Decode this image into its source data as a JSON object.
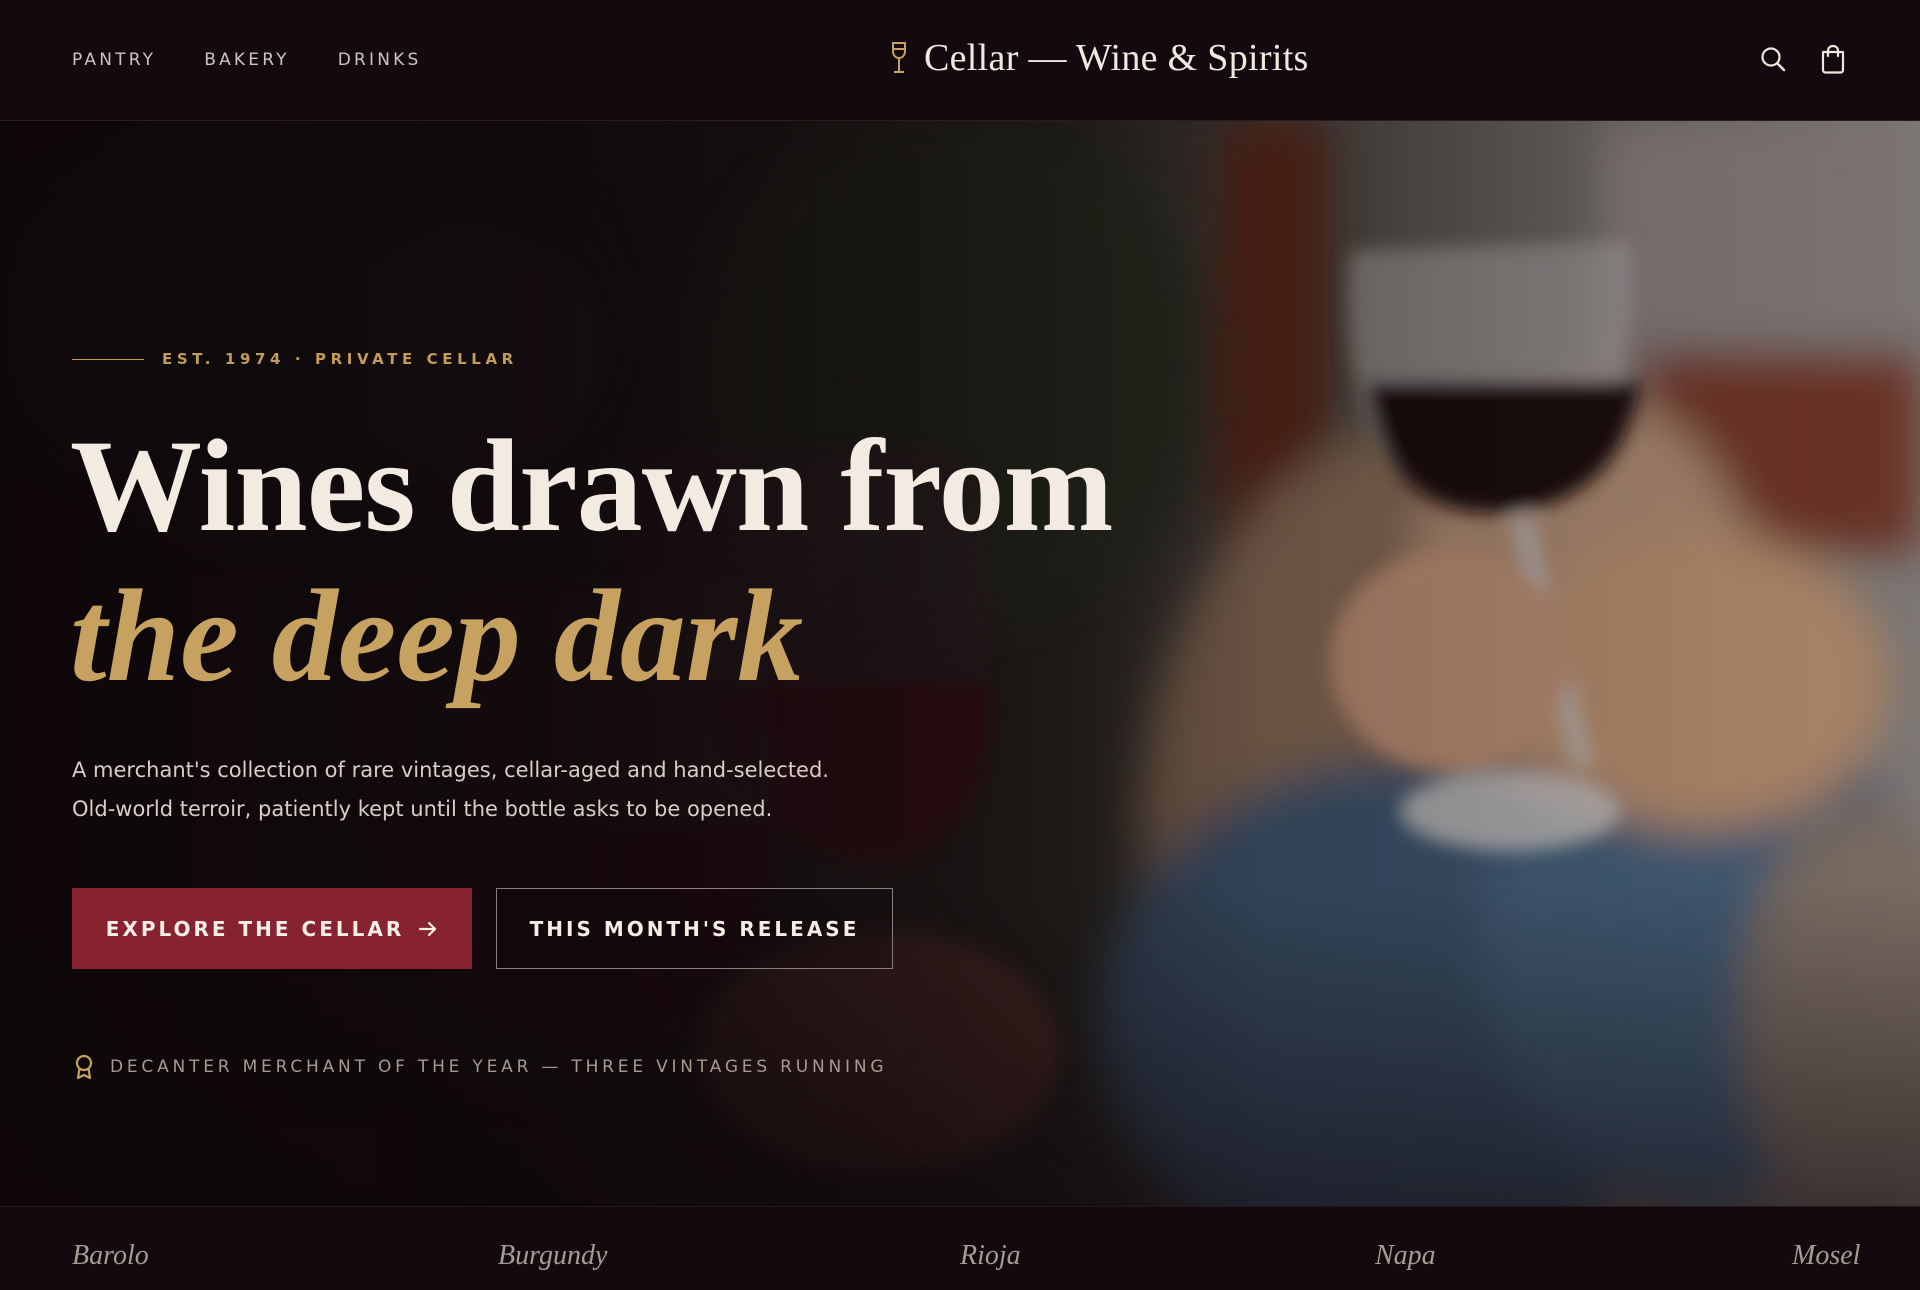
{
  "nav": {
    "links": [
      "PANTRY",
      "BAKERY",
      "DRINKS"
    ],
    "brand": "Cellar — Wine & Spirits",
    "brand_icon": "wine-glass-icon",
    "icons": [
      "search-icon",
      "shopping-bag-icon"
    ]
  },
  "hero": {
    "eyebrow": "EST. 1974 · PRIVATE CELLAR",
    "headline_line1": "Wines drawn from",
    "headline_line2": "the deep dark",
    "subcopy_line1": "A merchant's collection of rare vintages, cellar-aged and hand-selected.",
    "subcopy_line2": "Old-world terroir, patiently kept until the bottle asks to be opened.",
    "primary_cta": "EXPLORE THE CELLAR",
    "primary_cta_icon": "arrow-right-icon",
    "secondary_cta": "THIS MONTH'S RELEASE",
    "award_icon": "award-ribbon-icon",
    "award": "DECANTER MERCHANT OF THE YEAR — THREE VINTAGES RUNNING"
  },
  "regions": [
    "Barolo",
    "Burgundy",
    "Rioja",
    "Napa",
    "Mosel"
  ],
  "colors": {
    "background": "#130a0f",
    "accent_gold": "#c7a160",
    "accent_wine": "#86232f",
    "text_light": "#f3ebe1"
  }
}
